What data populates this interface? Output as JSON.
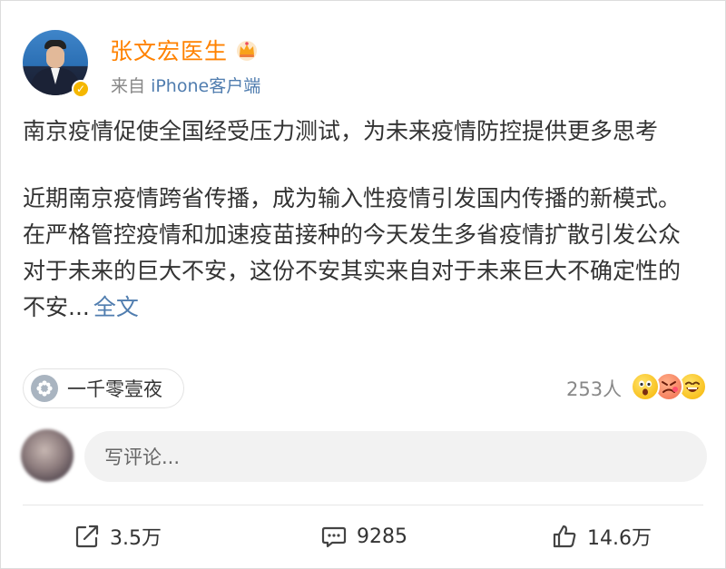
{
  "post": {
    "author_name": "张文宏医生",
    "source_prefix": "来自",
    "source_app": "iPhone客户端",
    "paragraph1": "南京疫情促使全国经受压力测试，为未来疫情防控提供更多思考",
    "paragraph2": "近期南京疫情跨省传播，成为输入性疫情引发国内传播的新模式。在严格管控疫情和加速疫苗接种的今天发生多省疫情扩散引发公众对于未来的巨大不安，这份不安其实来自对于未来巨大不确定性的不安...",
    "full_text_link": "全文",
    "topic_label": "一千零壹夜",
    "reaction_count": "253人",
    "reaction_icons": [
      "shocked-emoji-icon",
      "angry-emoji-icon",
      "laughing-emoji-icon"
    ]
  },
  "comment": {
    "placeholder": "写评论..."
  },
  "actions": {
    "share_count": "3.5万",
    "comment_count": "9285",
    "like_count": "14.6万"
  },
  "colors": {
    "author_name": "#ff8200",
    "link": "#507daf",
    "verified_badge": "#f5b700"
  }
}
